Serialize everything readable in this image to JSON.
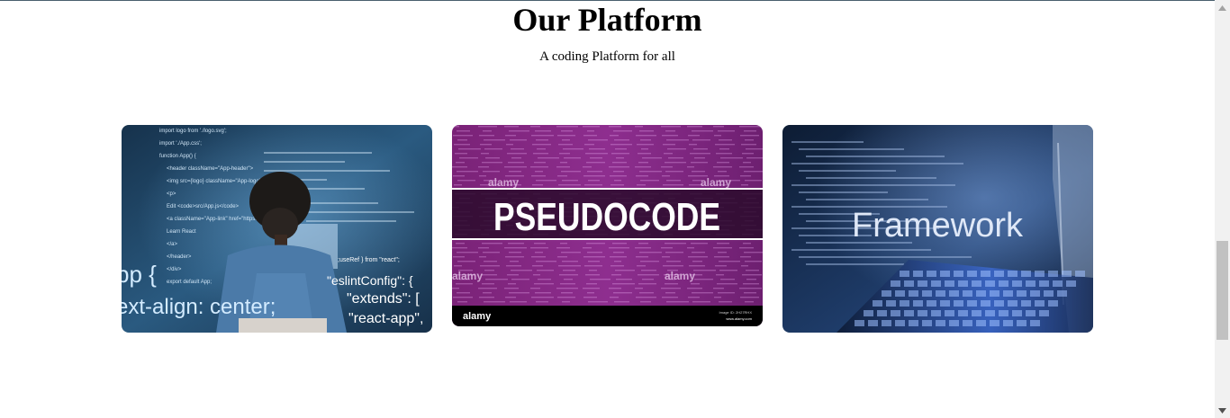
{
  "section": {
    "title": "Our Platform",
    "subtitle": "A coding Platform for all"
  },
  "cards": [
    {
      "image": "developer-coding-react-photo",
      "code_lines": [
        "import logo from './logo.svg';",
        "import './App.css';",
        "function App() {",
        "<header className=\"App-header\">",
        "<img src={logo} className=\"App-logo\"",
        "<p>",
        "Edit <code>src/App.js</code>",
        "<a className=\"App-link\" href=\"https://reactjs.org\"",
        "Learn React",
        "</a>",
        "</header>",
        "</div>",
        "export default App;"
      ],
      "overlay_lines": [
        ";useRef } from \"react\";",
        "\"eslintConfig\": {",
        "\"extends\": [",
        "\"react-app\","
      ],
      "big_text_1": "pp {",
      "big_text_2": "ext-align: center;"
    },
    {
      "image": "pseudocode-banner",
      "text": "PSEUDOCODE",
      "watermark": "alamy",
      "footer_brand": "alamy",
      "footer_id": "Image ID: 2H27RHX",
      "footer_url": "www.alamy.com"
    },
    {
      "image": "framework-laptop-photo",
      "text": "Framework"
    }
  ],
  "colors": {
    "card1_bg": "#1d3b57",
    "card2_bg": "#7b2480",
    "card3_bg": "#0f1f3a"
  },
  "scrollbar": {
    "up_icon": "triangle-up",
    "down_icon": "triangle-down"
  }
}
